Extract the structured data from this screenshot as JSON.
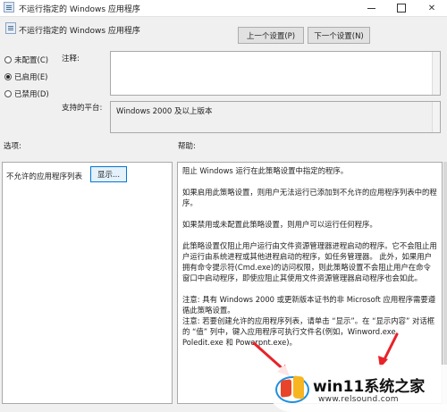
{
  "window": {
    "title": "不运行指定的 Windows 应用程序",
    "minimize_icon": "minimize-icon",
    "maximize_icon": "maximize-icon",
    "close_glyph": "✕"
  },
  "header": {
    "policy_name": "不运行指定的 Windows 应用程序",
    "prev_label": "上一个设置(P)",
    "next_label": "下一个设置(N)"
  },
  "state_options": {
    "not_configured": "未配置(C)",
    "enabled": "已启用(E)",
    "disabled": "已禁用(D)",
    "selected": "enabled"
  },
  "fields": {
    "comment_label": "注释:",
    "comment_value": "",
    "platform_label": "支持的平台:",
    "platform_value": "Windows 2000 及以上版本"
  },
  "sections": {
    "options_label": "选项:",
    "help_label": "帮助:"
  },
  "options": {
    "list_label": "不允许的应用程序列表",
    "show_button": "显示..."
  },
  "help": {
    "p1": "阻止 Windows 运行在此策略设置中指定的程序。",
    "p2": "如果启用此策略设置，则用户无法运行已添加到不允许的应用程序列表中的程序。",
    "p3": "如果禁用或未配置此策略设置，则用户可以运行任何程序。",
    "p4": "此策略设置仅阻止用户运行由文件资源管理器进程启动的程序。它不会阻止用户运行由系统进程或其他进程启动的程序，如任务管理器。 此外，如果用户拥有命令提示符(Cmd.exe)的访问权限，则此策略设置不会阻止用户在命令窗口中启动程序，即使应阻止其使用文件资源管理器启动程序也会如此。",
    "p5": "注意: 具有 Windows 2000 或更新版本证书的非 Microsoft 应用程序需要遵循此策略设置。",
    "p6": "注意: 若要创建允许的应用程序列表，请单击 “显示”。在 “显示内容” 对话框的 “值” 列中，键入应用程序可执行文件名(例如，Winword.exe、Poledit.exe 和 Powerpnt.exe)。"
  },
  "colors": {
    "arrow": "#e8222a",
    "accent_button_border": "#0078d7"
  },
  "watermark": {
    "title": "win11系统之家",
    "url": "www.relsound.com"
  }
}
